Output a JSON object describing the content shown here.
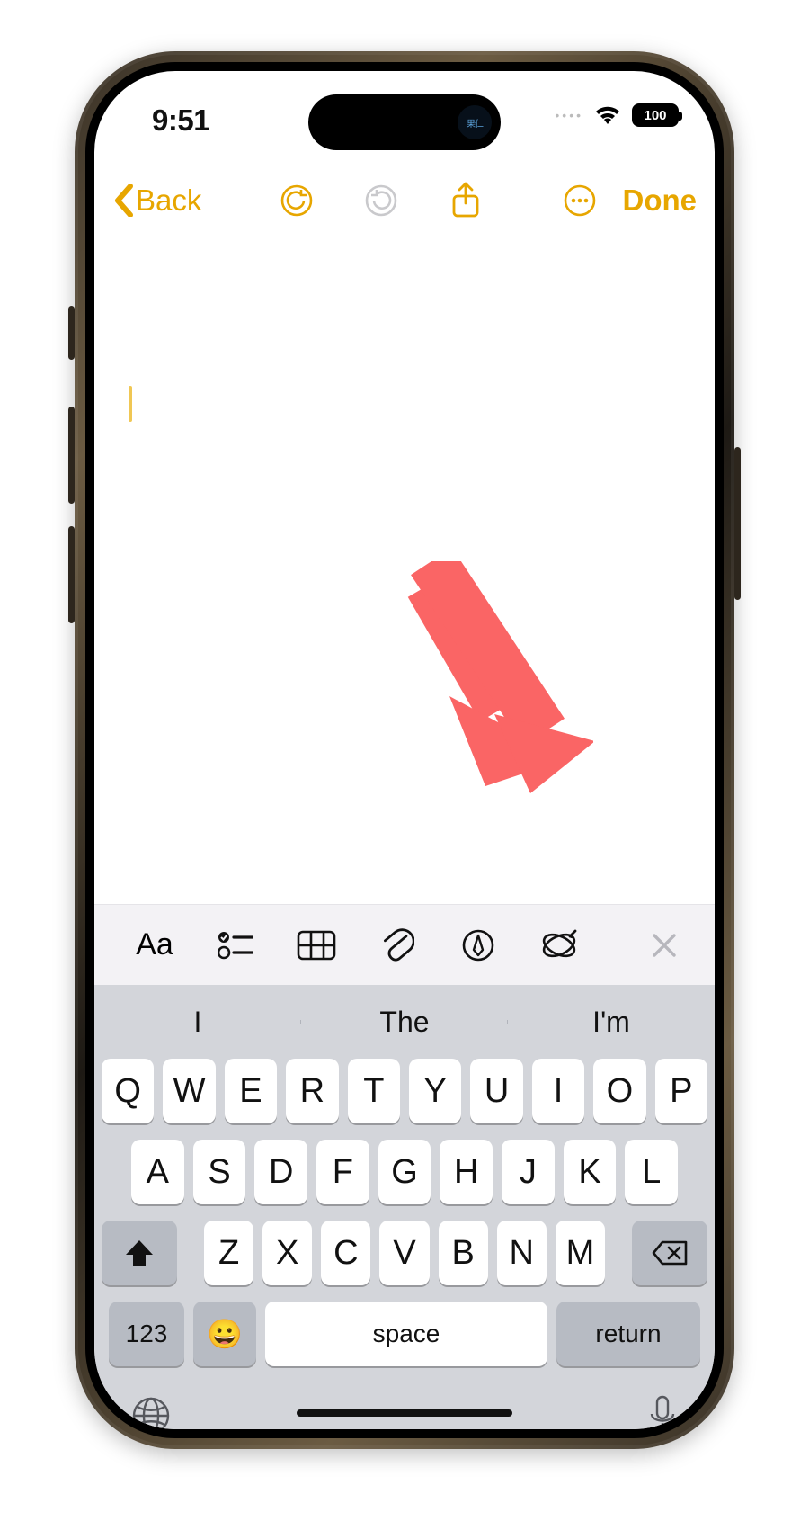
{
  "status": {
    "time": "9:51",
    "battery": "100",
    "island_text": "果仁"
  },
  "nav": {
    "back_label": "Back",
    "done_label": "Done"
  },
  "toolbar": {
    "text_style_label": "Aa"
  },
  "prediction": {
    "s1": "I",
    "s2": "The",
    "s3": "I'm"
  },
  "keyboard": {
    "row1": [
      "Q",
      "W",
      "E",
      "R",
      "T",
      "Y",
      "U",
      "I",
      "O",
      "P"
    ],
    "row2": [
      "A",
      "S",
      "D",
      "F",
      "G",
      "H",
      "J",
      "K",
      "L"
    ],
    "row3": [
      "Z",
      "X",
      "C",
      "V",
      "B",
      "N",
      "M"
    ],
    "numbers_label": "123",
    "space_label": "space",
    "return_label": "return"
  }
}
